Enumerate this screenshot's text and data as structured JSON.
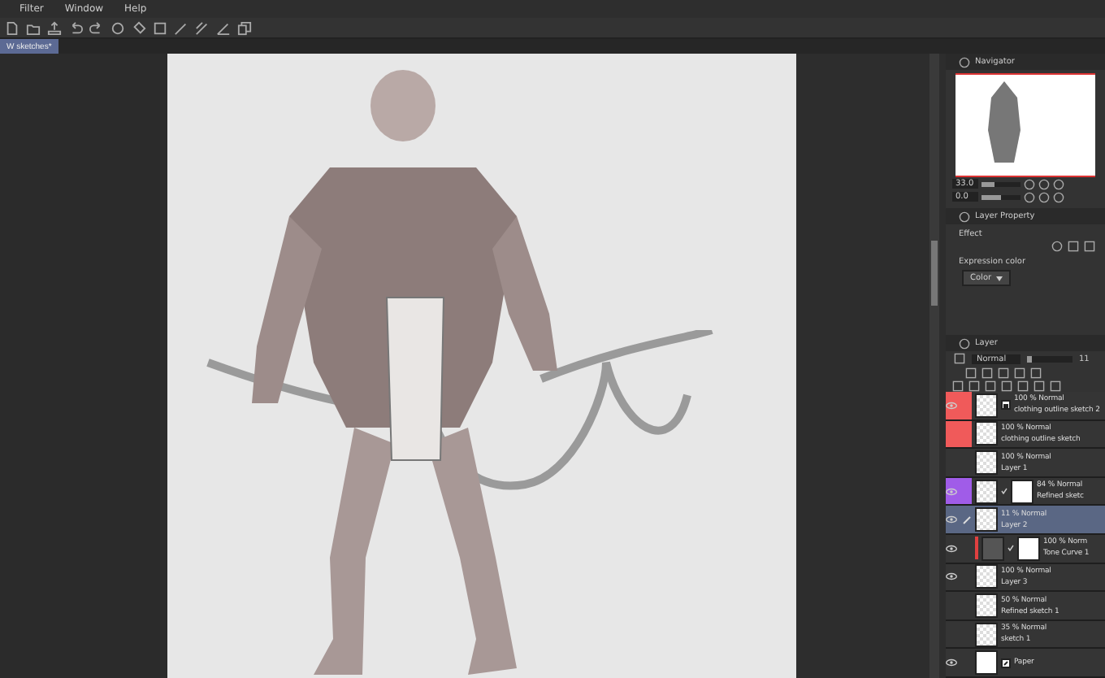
{
  "menu": [
    "Filter",
    "Window",
    "Help"
  ],
  "document_tab": {
    "label": "W sketches*",
    "selected": true
  },
  "navigator": {
    "title": "Navigator",
    "zoom": "33.0",
    "zoom_slider": {
      "level": 0.35
    },
    "rotation": "0.0",
    "rotation_slider": {
      "level": 0.5
    }
  },
  "layer_property": {
    "title": "Layer Property",
    "section": "Effect",
    "expression_label": "Expression color",
    "expression_value": "Color"
  },
  "layer_panel": {
    "title": "Layer",
    "blend_mode": "Normal",
    "opacity_slider": {
      "level": 0.11
    },
    "opacity": "11",
    "layers": [
      {
        "kind": "folder",
        "opacity_mode": "100 % Normal",
        "name": "clothing outline sketch 2",
        "visible": true,
        "selected": false,
        "color": "#f05a5a"
      },
      {
        "kind": "raster",
        "opacity_mode": "100 % Normal",
        "name": "clothing outline sketch",
        "visible": false,
        "selected": false,
        "color": "#f05a5a"
      },
      {
        "kind": "raster",
        "opacity_mode": "100 % Normal",
        "name": "Layer 1",
        "visible": false,
        "selected": false
      },
      {
        "kind": "masked",
        "opacity_mode": "84 % Normal",
        "name": "Refined sketc",
        "visible": true,
        "selected": false,
        "color": "#a05ce8"
      },
      {
        "kind": "raster",
        "opacity_mode": "11 % Normal",
        "name": "Layer 2",
        "visible": true,
        "selected": true
      },
      {
        "kind": "correction",
        "opacity_mode": "100 % Norm",
        "name": "Tone Curve 1",
        "visible": true,
        "selected": false
      },
      {
        "kind": "raster",
        "opacity_mode": "100 % Normal",
        "name": "Layer 3",
        "visible": true,
        "selected": false
      },
      {
        "kind": "raster",
        "opacity_mode": "50 % Normal",
        "name": "Refined sketch 1",
        "visible": false,
        "selected": false
      },
      {
        "kind": "raster",
        "opacity_mode": "35 % Normal",
        "name": "sketch 1",
        "visible": false,
        "selected": false
      },
      {
        "kind": "paper",
        "name": "Paper",
        "visible": true,
        "selected": false
      }
    ]
  }
}
